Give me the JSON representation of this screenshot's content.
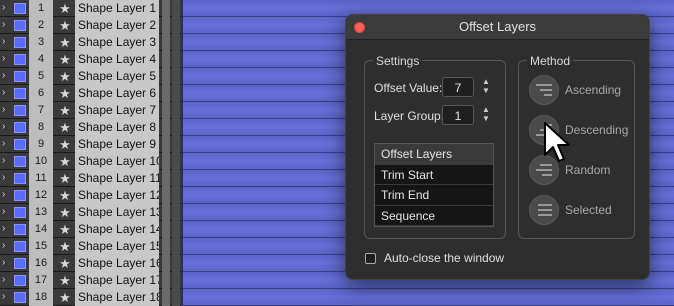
{
  "layers": [
    {
      "num": "1",
      "name": "Shape Layer 1"
    },
    {
      "num": "2",
      "name": "Shape Layer 2"
    },
    {
      "num": "3",
      "name": "Shape Layer 3"
    },
    {
      "num": "4",
      "name": "Shape Layer 4"
    },
    {
      "num": "5",
      "name": "Shape Layer 5"
    },
    {
      "num": "6",
      "name": "Shape Layer 6"
    },
    {
      "num": "7",
      "name": "Shape Layer 7"
    },
    {
      "num": "8",
      "name": "Shape Layer 8"
    },
    {
      "num": "9",
      "name": "Shape Layer 9"
    },
    {
      "num": "10",
      "name": "Shape Layer 10"
    },
    {
      "num": "11",
      "name": "Shape Layer 11"
    },
    {
      "num": "12",
      "name": "Shape Layer 12"
    },
    {
      "num": "13",
      "name": "Shape Layer 13"
    },
    {
      "num": "14",
      "name": "Shape Layer 14"
    },
    {
      "num": "15",
      "name": "Shape Layer 15"
    },
    {
      "num": "16",
      "name": "Shape Layer 16"
    },
    {
      "num": "17",
      "name": "Shape Layer 17"
    },
    {
      "num": "18",
      "name": "Shape Layer 18"
    }
  ],
  "icons": {
    "twirl": "chevron-right-icon",
    "star": "star-icon",
    "stepper": "stepper-icon",
    "method": "lines-icon",
    "cursor": "cursor-arrow-icon"
  },
  "colors": {
    "label_swatch": "#5b6bff",
    "timeline_bar": "#5a64c8",
    "close_button": "#ff5f57"
  },
  "dialog": {
    "title": "Offset Layers",
    "settings": {
      "heading": "Settings",
      "offset_label": "Offset Value:",
      "offset_value": "7",
      "group_label": "Layer Group:",
      "group_value": "1",
      "list": [
        "Offset Layers",
        "Trim Start",
        "Trim End",
        "Sequence"
      ]
    },
    "method": {
      "heading": "Method",
      "options": [
        "Ascending",
        "Descending",
        "Random",
        "Selected"
      ]
    },
    "auto_close_label": "Auto-close the window",
    "auto_close_checked": false
  }
}
